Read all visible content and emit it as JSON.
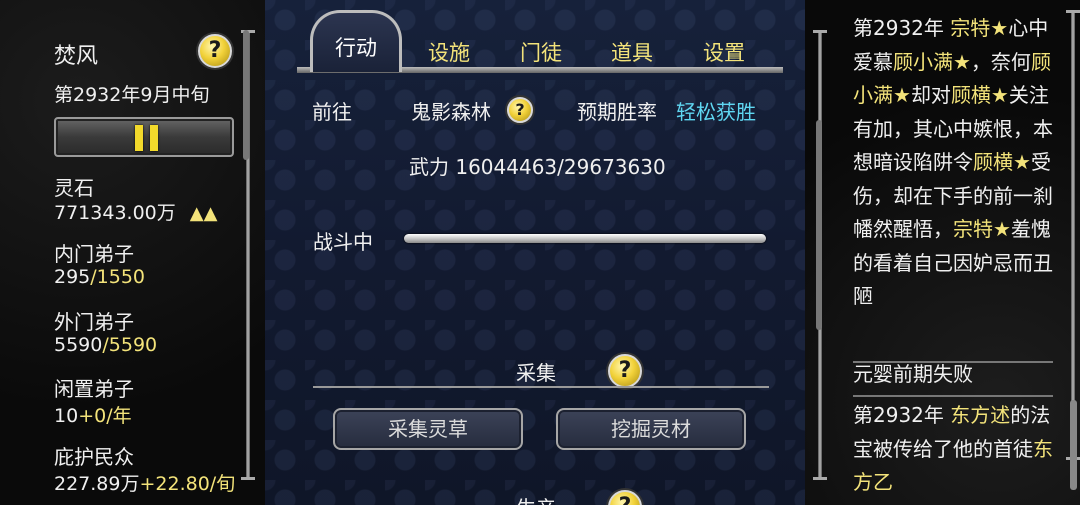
{
  "sect": {
    "name": "焚风",
    "date": "第2932年9月中旬",
    "resources": [
      {
        "label": "灵石",
        "value": "771343.00万",
        "trend": "▲▲"
      },
      {
        "label": "内门弟子",
        "current": "295",
        "max": "/1550"
      },
      {
        "label": "外门弟子",
        "current": "5590",
        "max": "/5590"
      },
      {
        "label": "闲置弟子",
        "current": "10",
        "rate": "+0/年"
      },
      {
        "label": "庇护民众",
        "current": "227.89万",
        "rate": "+22.80/旬"
      }
    ]
  },
  "tabs": [
    {
      "label": "行动",
      "active": true
    },
    {
      "label": "设施",
      "active": false
    },
    {
      "label": "门徒",
      "active": false
    },
    {
      "label": "道具",
      "active": false
    },
    {
      "label": "设置",
      "active": false
    }
  ],
  "action": {
    "goto_label": "前往",
    "destination": "鬼影森林",
    "win_rate_label": "预期胜率",
    "win_rate_value": "轻松获胜",
    "power_label": "武力",
    "power_value": "16044463/29673630",
    "status_label": "战斗中",
    "battle_progress": 1.0
  },
  "gather": {
    "title": "采集",
    "buttons": [
      "采集灵草",
      "挖掘灵材"
    ],
    "next_section": "生产"
  },
  "help_glyph": "?",
  "log": [
    {
      "segments": [
        {
          "text": "第2932年 ",
          "hl": false
        },
        {
          "text": "宗特★",
          "hl": true
        },
        {
          "text": "心中爱慕",
          "hl": false
        },
        {
          "text": "顾小满★",
          "hl": true
        },
        {
          "text": "，奈何",
          "hl": false
        },
        {
          "text": "顾小满★",
          "hl": true
        },
        {
          "text": "却对",
          "hl": false
        },
        {
          "text": "顾横★",
          "hl": true
        },
        {
          "text": "关注有加，其心中嫉恨，本想暗设陷阱令",
          "hl": false
        },
        {
          "text": "顾横★",
          "hl": true
        },
        {
          "text": "受伤，却在下手的前一刹幡然醒悟，",
          "hl": false
        },
        {
          "text": "宗特★",
          "hl": true
        },
        {
          "text": "羞愧的看着自己因妒忌而丑陋",
          "hl": false
        }
      ]
    },
    {
      "segments": [
        {
          "text": "元婴前期失败",
          "hl": false
        }
      ]
    },
    {
      "segments": [
        {
          "text": "第2932年 ",
          "hl": false
        },
        {
          "text": "东方述",
          "hl": true
        },
        {
          "text": "的法宝被传给了他的首徒",
          "hl": false
        },
        {
          "text": "东方乙",
          "hl": true
        }
      ]
    }
  ],
  "colors": {
    "highlight": "#f3e37a",
    "success": "#5fd7f2",
    "pause_bar": "#f2d92b"
  }
}
